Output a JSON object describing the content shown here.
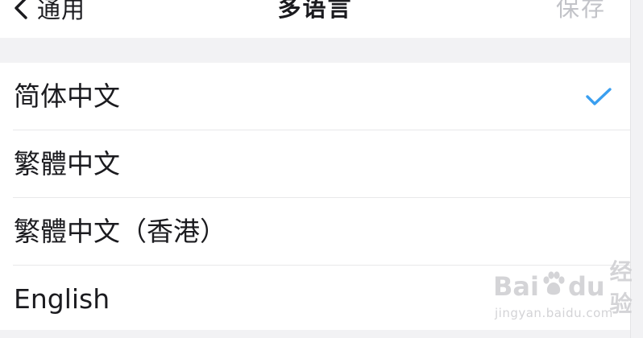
{
  "navbar": {
    "back_label": "通用",
    "title": "多语言",
    "save_label": "保存"
  },
  "languages": [
    {
      "label": "简体中文",
      "selected": true
    },
    {
      "label": "繁體中文",
      "selected": false
    },
    {
      "label": "繁體中文（香港）",
      "selected": false
    },
    {
      "label": "English",
      "selected": false
    }
  ],
  "watermark": {
    "brand_latin": "Bai",
    "brand_latin_2": "du",
    "brand_cn": "经验",
    "url": "jingyan.baidu.com"
  },
  "colors": {
    "accent": "#3a9ff0",
    "disabled_text": "#c2c3c8",
    "background": "#f2f2f4"
  },
  "icons": [
    "chevron-left-icon",
    "checkmark-icon",
    "paw-icon"
  ]
}
